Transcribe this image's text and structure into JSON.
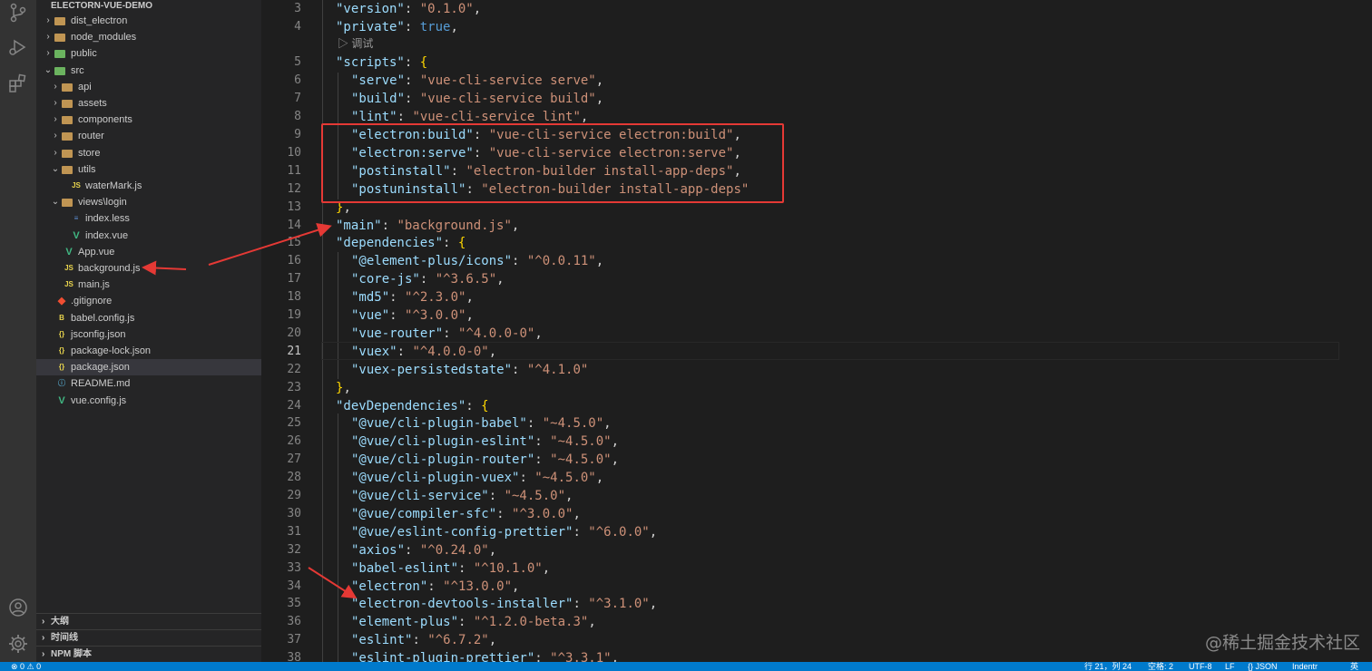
{
  "explorer": {
    "root": "ELECTORN-VUE-DEMO",
    "tree": [
      {
        "label": "dist_electron",
        "kind": "folder",
        "color": "brown",
        "depth": 1,
        "expanded": false
      },
      {
        "label": "node_modules",
        "kind": "folder",
        "color": "brown",
        "depth": 1,
        "expanded": false
      },
      {
        "label": "public",
        "kind": "folder",
        "color": "green",
        "depth": 1,
        "expanded": false
      },
      {
        "label": "src",
        "kind": "folder",
        "color": "green",
        "depth": 1,
        "expanded": true
      },
      {
        "label": "api",
        "kind": "folder",
        "color": "brown",
        "depth": 2,
        "expanded": false
      },
      {
        "label": "assets",
        "kind": "folder",
        "color": "brown",
        "depth": 2,
        "expanded": false
      },
      {
        "label": "components",
        "kind": "folder",
        "color": "brown",
        "depth": 2,
        "expanded": false
      },
      {
        "label": "router",
        "kind": "folder",
        "color": "brown",
        "depth": 2,
        "expanded": false
      },
      {
        "label": "store",
        "kind": "folder",
        "color": "brown",
        "depth": 2,
        "expanded": false
      },
      {
        "label": "utils",
        "kind": "folder",
        "color": "brown",
        "depth": 2,
        "expanded": true
      },
      {
        "label": "waterMark.js",
        "kind": "js",
        "depth": 3
      },
      {
        "label": "views\\login",
        "kind": "folder",
        "color": "brown",
        "depth": 2,
        "expanded": true
      },
      {
        "label": "index.less",
        "kind": "less",
        "depth": 3
      },
      {
        "label": "index.vue",
        "kind": "vue",
        "depth": 3
      },
      {
        "label": "App.vue",
        "kind": "vue",
        "depth": 2
      },
      {
        "label": "background.js",
        "kind": "js",
        "depth": 2
      },
      {
        "label": "main.js",
        "kind": "js",
        "depth": 2
      },
      {
        "label": ".gitignore",
        "kind": "git",
        "depth": 1
      },
      {
        "label": "babel.config.js",
        "kind": "babel",
        "depth": 1
      },
      {
        "label": "jsconfig.json",
        "kind": "json",
        "depth": 1
      },
      {
        "label": "package-lock.json",
        "kind": "json",
        "depth": 1
      },
      {
        "label": "package.json",
        "kind": "json",
        "depth": 1,
        "selected": true
      },
      {
        "label": "README.md",
        "kind": "md",
        "depth": 1
      },
      {
        "label": "vue.config.js",
        "kind": "vue",
        "depth": 1
      }
    ]
  },
  "panels": {
    "outline": "大纲",
    "timeline": "时间线",
    "npm": "NPM 脚本"
  },
  "codelens": "调试",
  "code_lines": [
    {
      "n": "3",
      "code": [
        [
          "k",
          "\"version\""
        ],
        [
          "p",
          ": "
        ],
        [
          "s",
          "\"0.1.0\""
        ],
        [
          "p",
          ","
        ]
      ],
      "indent": 1
    },
    {
      "n": "4",
      "code": [
        [
          "k",
          "\"private\""
        ],
        [
          "p",
          ": "
        ],
        [
          "b",
          "true"
        ],
        [
          "p",
          ","
        ]
      ],
      "indent": 1
    },
    {
      "n": "5",
      "code": [
        [
          "k",
          "\"scripts\""
        ],
        [
          "p",
          ": "
        ],
        [
          "br",
          "{"
        ]
      ],
      "indent": 1
    },
    {
      "n": "6",
      "code": [
        [
          "k",
          "\"serve\""
        ],
        [
          "p",
          ": "
        ],
        [
          "s",
          "\"vue-cli-service serve\""
        ],
        [
          "p",
          ","
        ]
      ],
      "indent": 2
    },
    {
      "n": "7",
      "code": [
        [
          "k",
          "\"build\""
        ],
        [
          "p",
          ": "
        ],
        [
          "s",
          "\"vue-cli-service build\""
        ],
        [
          "p",
          ","
        ]
      ],
      "indent": 2
    },
    {
      "n": "8",
      "code": [
        [
          "k",
          "\"lint\""
        ],
        [
          "p",
          ": "
        ],
        [
          "s",
          "\"vue-cli-service lint\""
        ],
        [
          "p",
          ","
        ]
      ],
      "indent": 2
    },
    {
      "n": "9",
      "code": [
        [
          "k",
          "\"electron:build\""
        ],
        [
          "p",
          ": "
        ],
        [
          "s",
          "\"vue-cli-service electron:build\""
        ],
        [
          "p",
          ","
        ]
      ],
      "indent": 2
    },
    {
      "n": "10",
      "code": [
        [
          "k",
          "\"electron:serve\""
        ],
        [
          "p",
          ": "
        ],
        [
          "s",
          "\"vue-cli-service electron:serve\""
        ],
        [
          "p",
          ","
        ]
      ],
      "indent": 2
    },
    {
      "n": "11",
      "code": [
        [
          "k",
          "\"postinstall\""
        ],
        [
          "p",
          ": "
        ],
        [
          "s",
          "\"electron-builder install-app-deps\""
        ],
        [
          "p",
          ","
        ]
      ],
      "indent": 2
    },
    {
      "n": "12",
      "code": [
        [
          "k",
          "\"postuninstall\""
        ],
        [
          "p",
          ": "
        ],
        [
          "s",
          "\"electron-builder install-app-deps\""
        ]
      ],
      "indent": 2
    },
    {
      "n": "13",
      "code": [
        [
          "br",
          "}"
        ],
        [
          "p",
          ","
        ]
      ],
      "indent": 1
    },
    {
      "n": "14",
      "code": [
        [
          "k",
          "\"main\""
        ],
        [
          "p",
          ": "
        ],
        [
          "s",
          "\"background.js\""
        ],
        [
          "p",
          ","
        ]
      ],
      "indent": 1
    },
    {
      "n": "15",
      "code": [
        [
          "k",
          "\"dependencies\""
        ],
        [
          "p",
          ": "
        ],
        [
          "br",
          "{"
        ]
      ],
      "indent": 1
    },
    {
      "n": "16",
      "code": [
        [
          "k",
          "\"@element-plus/icons\""
        ],
        [
          "p",
          ": "
        ],
        [
          "s",
          "\"^0.0.11\""
        ],
        [
          "p",
          ","
        ]
      ],
      "indent": 2
    },
    {
      "n": "17",
      "code": [
        [
          "k",
          "\"core-js\""
        ],
        [
          "p",
          ": "
        ],
        [
          "s",
          "\"^3.6.5\""
        ],
        [
          "p",
          ","
        ]
      ],
      "indent": 2
    },
    {
      "n": "18",
      "code": [
        [
          "k",
          "\"md5\""
        ],
        [
          "p",
          ": "
        ],
        [
          "s",
          "\"^2.3.0\""
        ],
        [
          "p",
          ","
        ]
      ],
      "indent": 2
    },
    {
      "n": "19",
      "code": [
        [
          "k",
          "\"vue\""
        ],
        [
          "p",
          ": "
        ],
        [
          "s",
          "\"^3.0.0\""
        ],
        [
          "p",
          ","
        ]
      ],
      "indent": 2
    },
    {
      "n": "20",
      "code": [
        [
          "k",
          "\"vue-router\""
        ],
        [
          "p",
          ": "
        ],
        [
          "s",
          "\"^4.0.0-0\""
        ],
        [
          "p",
          ","
        ]
      ],
      "indent": 2
    },
    {
      "n": "21",
      "code": [
        [
          "k",
          "\"vuex\""
        ],
        [
          "p",
          ": "
        ],
        [
          "s",
          "\"^4.0.0-0\""
        ],
        [
          "p",
          ","
        ]
      ],
      "indent": 2,
      "current": true
    },
    {
      "n": "22",
      "code": [
        [
          "k",
          "\"vuex-persistedstate\""
        ],
        [
          "p",
          ": "
        ],
        [
          "s",
          "\"^4.1.0\""
        ]
      ],
      "indent": 2
    },
    {
      "n": "23",
      "code": [
        [
          "br",
          "}"
        ],
        [
          "p",
          ","
        ]
      ],
      "indent": 1
    },
    {
      "n": "24",
      "code": [
        [
          "k",
          "\"devDependencies\""
        ],
        [
          "p",
          ": "
        ],
        [
          "br",
          "{"
        ]
      ],
      "indent": 1
    },
    {
      "n": "25",
      "code": [
        [
          "k",
          "\"@vue/cli-plugin-babel\""
        ],
        [
          "p",
          ": "
        ],
        [
          "s",
          "\"~4.5.0\""
        ],
        [
          "p",
          ","
        ]
      ],
      "indent": 2
    },
    {
      "n": "26",
      "code": [
        [
          "k",
          "\"@vue/cli-plugin-eslint\""
        ],
        [
          "p",
          ": "
        ],
        [
          "s",
          "\"~4.5.0\""
        ],
        [
          "p",
          ","
        ]
      ],
      "indent": 2
    },
    {
      "n": "27",
      "code": [
        [
          "k",
          "\"@vue/cli-plugin-router\""
        ],
        [
          "p",
          ": "
        ],
        [
          "s",
          "\"~4.5.0\""
        ],
        [
          "p",
          ","
        ]
      ],
      "indent": 2
    },
    {
      "n": "28",
      "code": [
        [
          "k",
          "\"@vue/cli-plugin-vuex\""
        ],
        [
          "p",
          ": "
        ],
        [
          "s",
          "\"~4.5.0\""
        ],
        [
          "p",
          ","
        ]
      ],
      "indent": 2
    },
    {
      "n": "29",
      "code": [
        [
          "k",
          "\"@vue/cli-service\""
        ],
        [
          "p",
          ": "
        ],
        [
          "s",
          "\"~4.5.0\""
        ],
        [
          "p",
          ","
        ]
      ],
      "indent": 2
    },
    {
      "n": "30",
      "code": [
        [
          "k",
          "\"@vue/compiler-sfc\""
        ],
        [
          "p",
          ": "
        ],
        [
          "s",
          "\"^3.0.0\""
        ],
        [
          "p",
          ","
        ]
      ],
      "indent": 2
    },
    {
      "n": "31",
      "code": [
        [
          "k",
          "\"@vue/eslint-config-prettier\""
        ],
        [
          "p",
          ": "
        ],
        [
          "s",
          "\"^6.0.0\""
        ],
        [
          "p",
          ","
        ]
      ],
      "indent": 2
    },
    {
      "n": "32",
      "code": [
        [
          "k",
          "\"axios\""
        ],
        [
          "p",
          ": "
        ],
        [
          "s",
          "\"^0.24.0\""
        ],
        [
          "p",
          ","
        ]
      ],
      "indent": 2
    },
    {
      "n": "33",
      "code": [
        [
          "k",
          "\"babel-eslint\""
        ],
        [
          "p",
          ": "
        ],
        [
          "s",
          "\"^10.1.0\""
        ],
        [
          "p",
          ","
        ]
      ],
      "indent": 2
    },
    {
      "n": "34",
      "code": [
        [
          "k",
          "\"electron\""
        ],
        [
          "p",
          ": "
        ],
        [
          "s",
          "\"^13.0.0\""
        ],
        [
          "p",
          ","
        ]
      ],
      "indent": 2
    },
    {
      "n": "35",
      "code": [
        [
          "k",
          "\"electron-devtools-installer\""
        ],
        [
          "p",
          ": "
        ],
        [
          "s",
          "\"^3.1.0\""
        ],
        [
          "p",
          ","
        ]
      ],
      "indent": 2
    },
    {
      "n": "36",
      "code": [
        [
          "k",
          "\"element-plus\""
        ],
        [
          "p",
          ": "
        ],
        [
          "s",
          "\"^1.2.0-beta.3\""
        ],
        [
          "p",
          ","
        ]
      ],
      "indent": 2
    },
    {
      "n": "37",
      "code": [
        [
          "k",
          "\"eslint\""
        ],
        [
          "p",
          ": "
        ],
        [
          "s",
          "\"^6.7.2\""
        ],
        [
          "p",
          ","
        ]
      ],
      "indent": 2
    },
    {
      "n": "38",
      "code": [
        [
          "k",
          "\"eslint-plugin-prettier\""
        ],
        [
          "p",
          ": "
        ],
        [
          "s",
          "\"^3.3.1\""
        ],
        [
          "p",
          ","
        ]
      ],
      "indent": 2
    }
  ],
  "watermark": "@稀土掘金技术社区",
  "status": {
    "errors": "⊗ 0 ⚠ 0",
    "position": "行 21，列 24",
    "spaces": "空格: 2",
    "encoding": "UTF-8",
    "eol": "LF",
    "language": "{} JSON",
    "indent": "Indentr",
    "ime": "英"
  },
  "colors": {
    "annotation_red": "#e53935",
    "statusbar_blue": "#007acc"
  }
}
